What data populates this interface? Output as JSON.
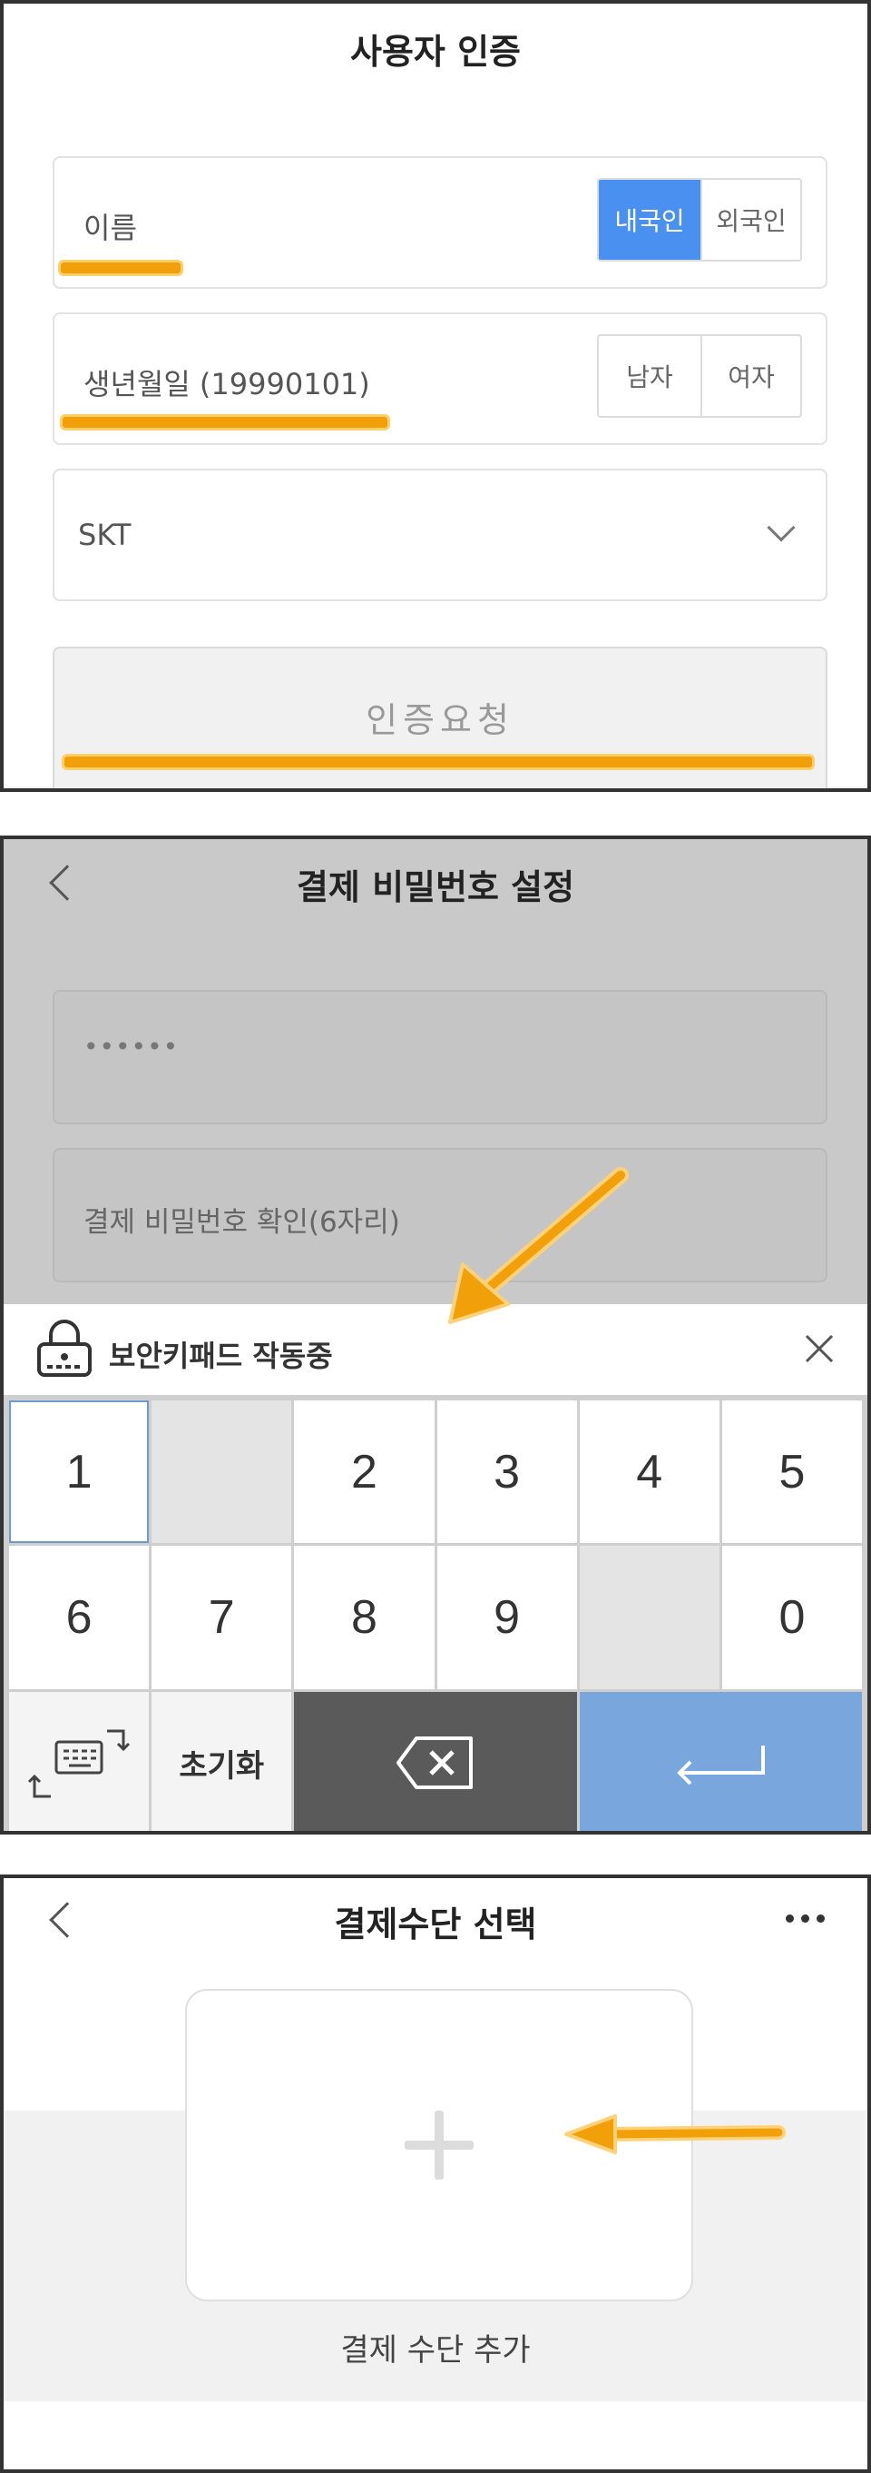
{
  "auth": {
    "title": "사용자 인증",
    "name_placeholder": "이름",
    "nationality": [
      "내국인",
      "외국인"
    ],
    "birth_placeholder": "생년월일 (19990101)",
    "gender": [
      "남자",
      "여자"
    ],
    "carrier": "SKT",
    "request_button": "인증요청"
  },
  "password": {
    "title": "결제 비밀번호 설정",
    "password_value": "••••••",
    "confirm_placeholder": "결제 비밀번호 확인(6자리)",
    "keypad_status": "보안키패드 작동중",
    "keys_row1": [
      "1",
      "",
      "2",
      "3",
      "4",
      "5"
    ],
    "keys_row2": [
      "6",
      "7",
      "8",
      "9",
      "",
      "0"
    ],
    "reset_label": "초기화"
  },
  "payment": {
    "title": "결제수단 선택",
    "add_label": "결제 수단 추가"
  },
  "colors": {
    "accent_blue": "#4a90f0",
    "highlight_orange": "#f2a00a",
    "enter_key": "#79a6dc",
    "backspace_key": "#5a5a5a"
  }
}
